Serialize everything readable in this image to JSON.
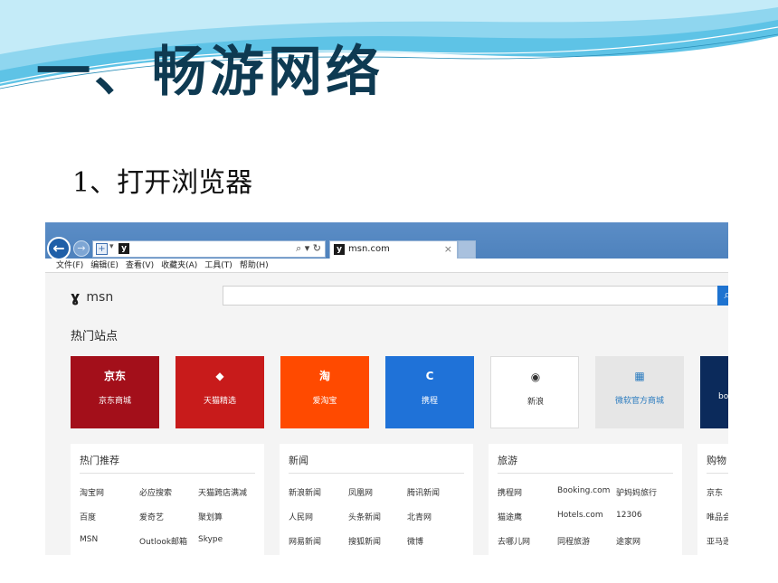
{
  "slide": {
    "title": "一、畅游网络",
    "subtitle": "1、打开浏览器"
  },
  "colors": {
    "title": "#0e3a52",
    "wave": "#5ec3e6",
    "browser_chrome": "#4e82bd",
    "search_button": "#1e73d0"
  },
  "browser": {
    "nav": {
      "back_icon": "back-arrow-icon",
      "back_glyph": "←",
      "forward_glyph": "→"
    },
    "address_bar": {
      "value": "",
      "tools_glyph": "⌕ ▾ ↻"
    },
    "tab": {
      "title": "msn.com",
      "close_glyph": "×"
    },
    "menu": [
      "文件(F)",
      "编辑(E)",
      "查看(V)",
      "收藏夹(A)",
      "工具(T)",
      "帮助(H)"
    ],
    "page": {
      "logo_text": "msn",
      "search_placeholder": "",
      "search_glyph": "⌕",
      "hot_sites_heading": "热门站点",
      "tiles": [
        {
          "label": "京东商城",
          "icon_text": "京东",
          "bg": "#a30f1a",
          "fg": "#ffffff"
        },
        {
          "label": "天猫精选",
          "icon_text": "◆",
          "bg": "#c81b1b",
          "fg": "#ffffff"
        },
        {
          "label": "爱淘宝",
          "icon_text": "淘",
          "bg": "#ff4a00",
          "fg": "#ffffff"
        },
        {
          "label": "携程",
          "icon_text": "C",
          "bg": "#1f72d8",
          "fg": "#ffffff"
        },
        {
          "label": "新浪",
          "icon_text": "◉",
          "bg": "#ffffff",
          "fg": "#333333"
        },
        {
          "label": "微软官方商城",
          "icon_text": "▦",
          "bg": "#e6e6e6",
          "fg": "#2a7bbf"
        },
        {
          "label": "bo",
          "icon_text": "",
          "bg": "#0b2a5b",
          "fg": "#ffffff"
        }
      ],
      "cards": [
        {
          "title": "热门推荐",
          "rows": [
            [
              "淘宝网",
              "必应搜索",
              "天猫跨店满减"
            ],
            [
              "百度",
              "爱奇艺",
              "聚划算"
            ],
            [
              "MSN",
              "Outlook邮箱",
              "Skype"
            ]
          ]
        },
        {
          "title": "新闻",
          "rows": [
            [
              "新浪新闻",
              "凤凰网",
              "腾讯新闻"
            ],
            [
              "人民网",
              "头条新闻",
              "北青网"
            ],
            [
              "网易新闻",
              "搜狐新闻",
              "微博"
            ]
          ]
        },
        {
          "title": "旅游",
          "rows": [
            [
              "携程网",
              "Booking.com",
              "驴妈妈旅行"
            ],
            [
              "猫途鹰",
              "Hotels.com",
              "12306"
            ],
            [
              "去哪儿网",
              "同程旅游",
              "途家网"
            ]
          ]
        },
        {
          "title": "购物",
          "rows": [
            [
              "京东",
              "",
              ""
            ],
            [
              "唯品会",
              "",
              ""
            ],
            [
              "亚马逊",
              "",
              ""
            ]
          ]
        }
      ]
    }
  }
}
